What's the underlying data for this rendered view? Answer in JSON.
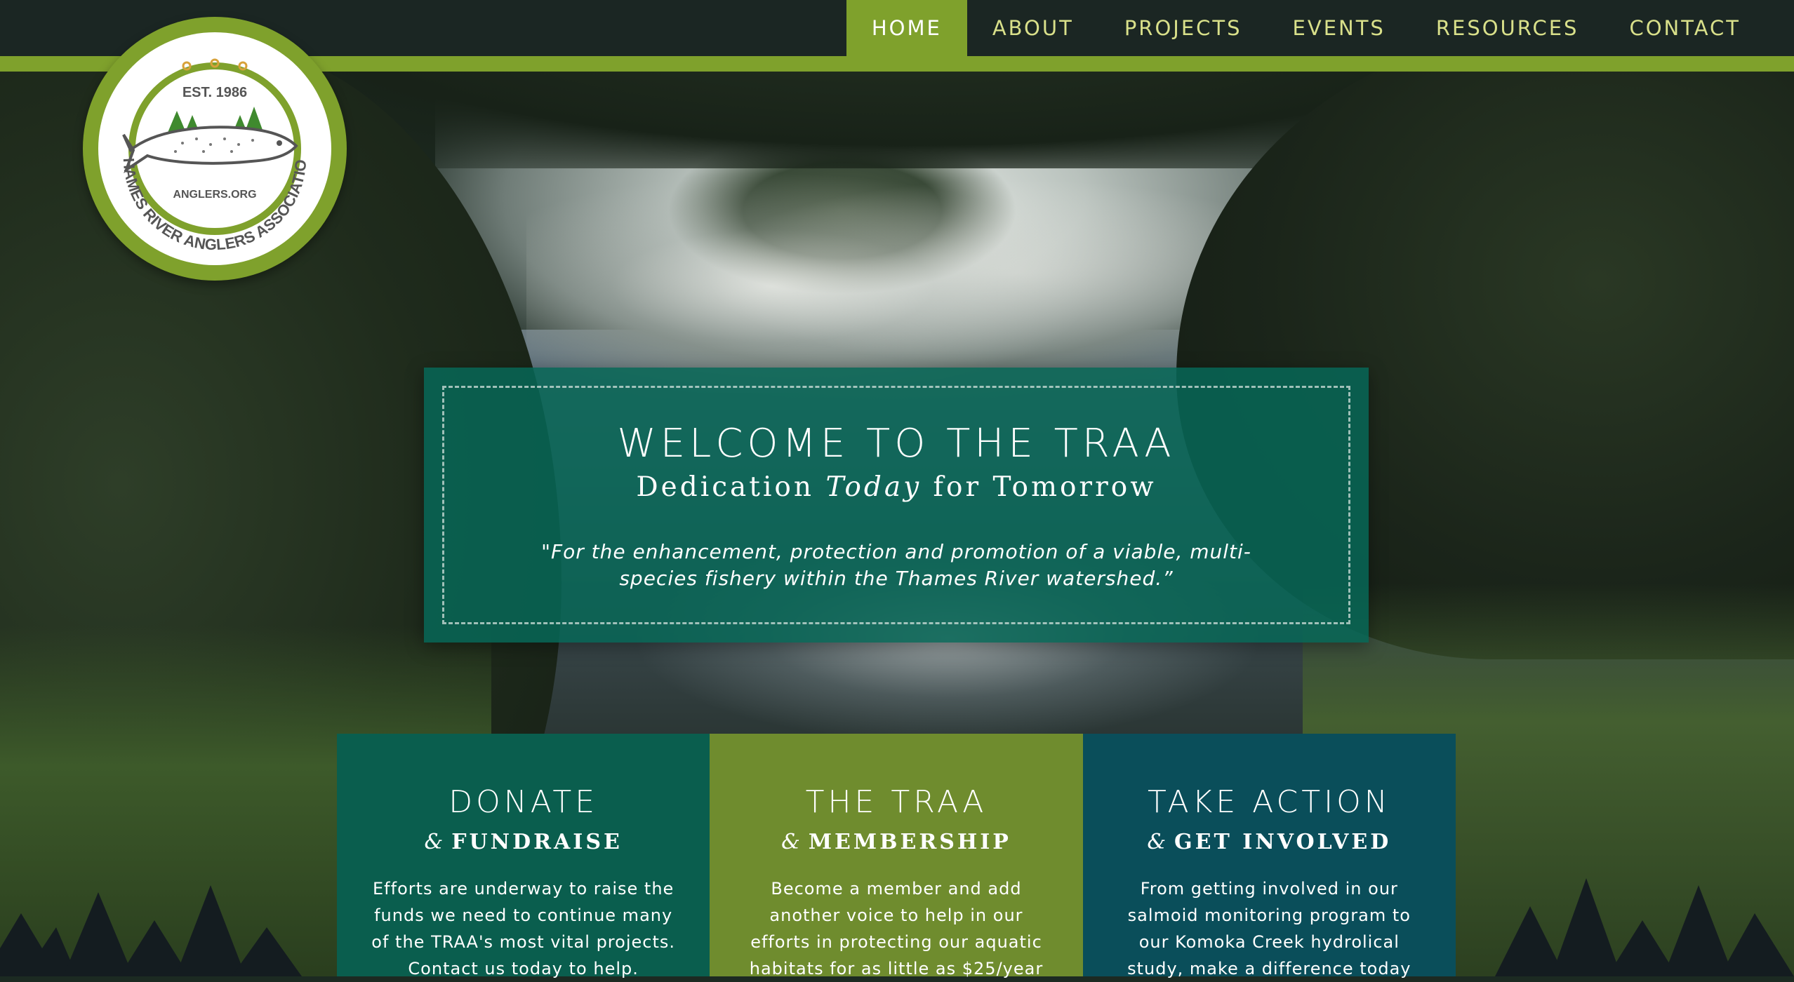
{
  "nav": {
    "items": [
      {
        "label": "HOME",
        "active": true
      },
      {
        "label": "ABOUT",
        "active": false
      },
      {
        "label": "PROJECTS",
        "active": false
      },
      {
        "label": "EVENTS",
        "active": false
      },
      {
        "label": "RESOURCES",
        "active": false
      },
      {
        "label": "CONTACT",
        "active": false
      }
    ]
  },
  "logo": {
    "est": "EST. 1986",
    "site": "ANGLERS.ORG",
    "name": "THAMES RIVER ANGLERS ASSOCIATION"
  },
  "hero": {
    "title": "WELCOME TO THE TRAA",
    "subtitle_before": "Dedication ",
    "subtitle_em": "Today",
    "subtitle_after": " for Tomorrow",
    "quote": "\"For the enhancement, protection and promotion of a viable, multi-species fishery within the Thames River watershed.”"
  },
  "cards": [
    {
      "title": "DONATE",
      "amp": "&",
      "subtitle": "FUNDRAISE",
      "text": "Efforts are underway to raise the funds we need to continue many of the TRAA's most vital projects. Contact us today to help."
    },
    {
      "title": "THE TRAA",
      "amp": "&",
      "subtitle": "MEMBERSHIP",
      "text": "Become a member and add another voice to help in our efforts in protecting our aquatic habitats for as little as $25/year"
    },
    {
      "title": "TAKE ACTION",
      "amp": "&",
      "subtitle": "GET INVOLVED",
      "text": "From getting involved in our salmoid monitoring program to our Komoka Creek hydrolical study, make a difference today"
    }
  ],
  "colors": {
    "accent_green": "#7fa12c",
    "nav_text": "#d9e08a",
    "hero_teal": "#076656",
    "card_donate": "#0a5e4e",
    "card_traa": "#6f8c2e",
    "card_action": "#0a4e5a"
  }
}
